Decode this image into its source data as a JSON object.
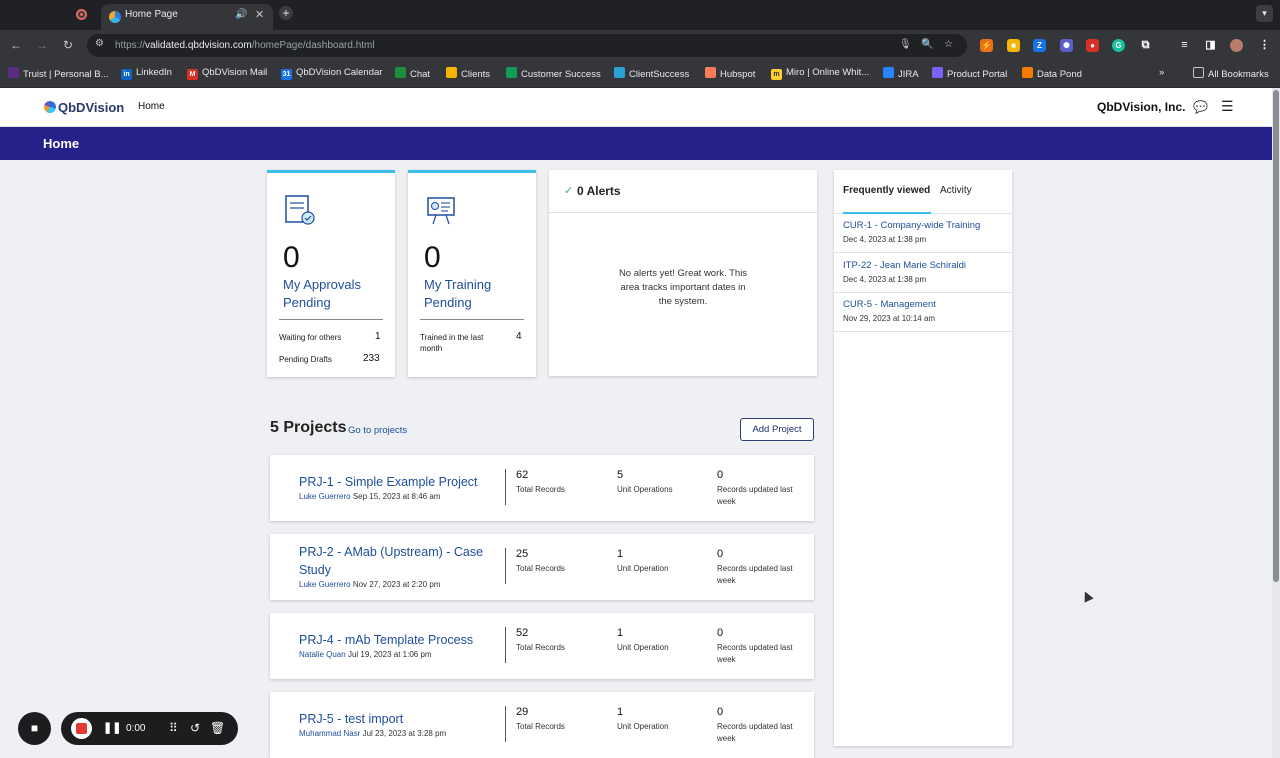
{
  "browser": {
    "tab_title": "Home Page",
    "tab_audio_icon": "speaker-icon",
    "url_scheme": "https://",
    "url_domain": "validated.qbdvision.com",
    "url_path": "/homePage/dashboard.html",
    "bookmarks": [
      {
        "label": "Truist | Personal B...",
        "color": "#5b2c83"
      },
      {
        "label": "LinkedIn",
        "color": "#0a66c2"
      },
      {
        "label": "QbDVision Mail",
        "color": "#d93025"
      },
      {
        "label": "QbDVision Calendar",
        "color": "#1a73e8"
      },
      {
        "label": "Chat",
        "color": "#1e8e3e"
      },
      {
        "label": "Clients",
        "color": "#f4b400"
      },
      {
        "label": "Customer Success",
        "color": "#0f9d58"
      },
      {
        "label": "ClientSuccess",
        "color": "#29a3d6"
      },
      {
        "label": "Hubspot",
        "color": "#ff7a59"
      },
      {
        "label": "Miro | Online Whit...",
        "color": "#ffd02f"
      },
      {
        "label": "JIRA",
        "color": "#2684ff"
      },
      {
        "label": "Product Portal",
        "color": "#7b61ff"
      },
      {
        "label": "Data Pond",
        "color": "#f57c00"
      }
    ],
    "all_bookmarks": "All Bookmarks",
    "bookmarks_overflow": "»"
  },
  "header": {
    "logo_text": "QbDVision",
    "nav_home": "Home",
    "company": "QbDVision, Inc."
  },
  "page": {
    "title": "Home"
  },
  "approvals": {
    "count": "0",
    "label": "My Approvals Pending",
    "rows": [
      {
        "label": "Waiting for others",
        "value": "1"
      },
      {
        "label": "Pending Drafts",
        "value": "233"
      }
    ]
  },
  "training": {
    "count": "0",
    "label": "My Training Pending",
    "rows": [
      {
        "label": "Trained in the last month",
        "value": "4"
      }
    ]
  },
  "alerts": {
    "title": "0 Alerts",
    "empty_text": "No alerts yet! Great work. This area tracks important dates in the system."
  },
  "side_panel": {
    "tabs": [
      "Frequently viewed",
      "Activity"
    ],
    "items": [
      {
        "title": "CUR-1 - Company-wide Training",
        "date": "Dec 4, 2023 at 1:38 pm"
      },
      {
        "title": "ITP-22 - Jean Marie Schiraldi",
        "date": "Dec 4, 2023 at 1:38 pm"
      },
      {
        "title": "CUR-5 - Management",
        "date": "Nov 29, 2023 at 10:14 am"
      }
    ]
  },
  "projects": {
    "title": "5 Projects",
    "go_link": "Go to projects",
    "add_button": "Add Project",
    "list": [
      {
        "name": "PRJ-1 - Simple Example Project",
        "author": "Luke Guerrero",
        "date": "Sep 15, 2023 at 8:46 am",
        "records": "62",
        "records_label": "Total Records",
        "units": "5",
        "units_label": "Unit Operations",
        "updated": "0",
        "updated_label": "Records updated last week"
      },
      {
        "name": "PRJ-2 - AMab (Upstream) - Case Study",
        "author": "Luke Guerrero",
        "date": "Nov 27, 2023 at 2:20 pm",
        "records": "25",
        "records_label": "Total Records",
        "units": "1",
        "units_label": "Unit Operation",
        "updated": "0",
        "updated_label": "Records updated last week"
      },
      {
        "name": "PRJ-4 - mAb Template Process",
        "author": "Natalie Quan",
        "date": "Jul 19, 2023 at 1:06 pm",
        "records": "52",
        "records_label": "Total Records",
        "units": "1",
        "units_label": "Unit Operation",
        "updated": "0",
        "updated_label": "Records updated last week"
      },
      {
        "name": "PRJ-5 - test import",
        "author": "Muhammad Nasr",
        "date": "Jul 23, 2023 at 3:28 pm",
        "records": "29",
        "records_label": "Total Records",
        "units": "1",
        "units_label": "Unit Operation",
        "updated": "0",
        "updated_label": "Records updated last week"
      }
    ]
  },
  "recorder": {
    "time": "0:00"
  },
  "colors": {
    "title_bar": "#25208a",
    "accent": "#3dbde9",
    "link": "#1f4e9a"
  }
}
